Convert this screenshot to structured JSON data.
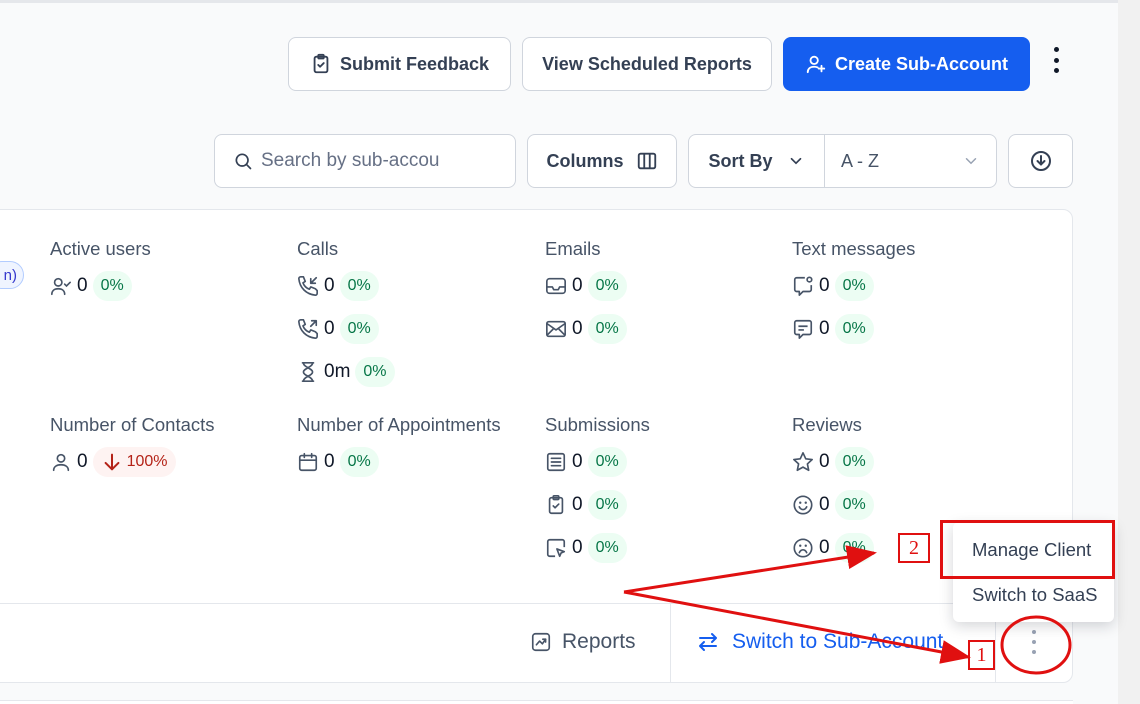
{
  "header": {
    "submit_feedback": "Submit Feedback",
    "view_scheduled_reports": "View Scheduled Reports",
    "create_sub_account": "Create Sub-Account"
  },
  "toolbar": {
    "search_placeholder": "Search by sub-accou",
    "columns_label": "Columns",
    "sort_by_label": "Sort By",
    "sort_value": "A - Z"
  },
  "card": {
    "status_pill_fragment": "n)",
    "metrics": [
      {
        "title": "Active users",
        "rows": [
          {
            "icon": "user-check-icon",
            "value": "0",
            "change": "0%"
          }
        ]
      },
      {
        "title": "Calls",
        "rows": [
          {
            "icon": "phone-incoming-icon",
            "value": "0",
            "change": "0%"
          },
          {
            "icon": "phone-outgoing-icon",
            "value": "0",
            "change": "0%"
          },
          {
            "icon": "hourglass-icon",
            "value": "0m",
            "change": "0%"
          }
        ]
      },
      {
        "title": "Emails",
        "rows": [
          {
            "icon": "inbox-icon",
            "value": "0",
            "change": "0%"
          },
          {
            "icon": "mail-icon",
            "value": "0",
            "change": "0%"
          }
        ]
      },
      {
        "title": "Text messages",
        "rows": [
          {
            "icon": "message-notification-icon",
            "value": "0",
            "change": "0%"
          },
          {
            "icon": "message-text-icon",
            "value": "0",
            "change": "0%"
          }
        ]
      },
      {
        "title": "Number of Contacts",
        "rows": [
          {
            "icon": "user-icon",
            "value": "0",
            "change": "100%",
            "direction": "down"
          }
        ]
      },
      {
        "title": "Number of Appointments",
        "rows": [
          {
            "icon": "calendar-icon",
            "value": "0",
            "change": "0%"
          }
        ]
      },
      {
        "title": "Submissions",
        "rows": [
          {
            "icon": "form-icon",
            "value": "0",
            "change": "0%"
          },
          {
            "icon": "clipboard-check-icon",
            "value": "0",
            "change": "0%"
          },
          {
            "icon": "cursor-box-icon",
            "value": "0",
            "change": "0%"
          }
        ]
      },
      {
        "title": "Reviews",
        "rows": [
          {
            "icon": "star-icon",
            "value": "0",
            "change": "0%"
          },
          {
            "icon": "face-smile-icon",
            "value": "0",
            "change": "0%"
          },
          {
            "icon": "face-sad-icon",
            "value": "0",
            "change": "0%"
          }
        ]
      }
    ],
    "footer": {
      "reports": "Reports",
      "switch": "Switch to Sub-Account"
    }
  },
  "dropdown": {
    "items": [
      "Manage Client",
      "Switch to SaaS"
    ]
  },
  "annotations": {
    "label_1": "1",
    "label_2": "2",
    "color": "#e01010"
  },
  "colors": {
    "primary": "#155eef",
    "positive_bg": "#ecfdf3",
    "positive_text": "#067647",
    "negative_bg": "#fef3f2",
    "negative_text": "#b42318"
  }
}
